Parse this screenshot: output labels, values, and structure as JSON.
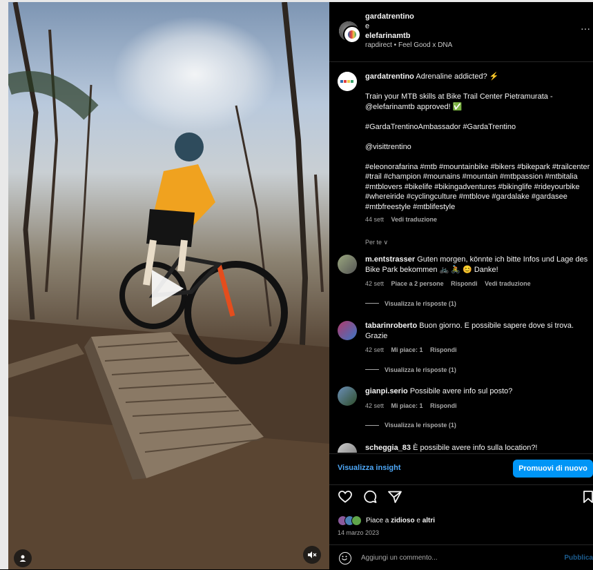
{
  "header": {
    "user1": "gardatrentino",
    "joiner": "e",
    "user2": "elefarinamtb",
    "audio": "rapdirect • Feel Good x DNA",
    "more": "···"
  },
  "caption": {
    "username": "gardatrentino",
    "first_line": "Adrenaline addicted? ⚡",
    "p1": "Train your MTB skills at Bike Trail Center Pietramurata - @elefarinamtb approved! ✅",
    "p2": "#GardaTrentinoAmbassador #GardaTrentino",
    "p3": "@visittrentino",
    "p4": "#eleonorafarina #mtb #mountainbike #bikers #bikepark #trailcenter #trail #champion #mounains #mountain #mtbpassion #mtbitalia #mtblovers #bikelife #bikingadventures #bikinglife #rideyourbike #whereiride #cyclingculture #mtblove #gardalake #gardasee #mtbfreestyle #mtblifestyle",
    "time": "44 sett",
    "translate": "Vedi traduzione",
    "for_you": "Per te ∨"
  },
  "comments": [
    {
      "username": "m.entstrasser",
      "text": "Guten morgen, könnte ich bitte Infos und Lage des Bike Park bekommen 🚲 🚴 😊 Danke!",
      "time": "42 sett",
      "likes": "Piace a 2 persone",
      "reply": "Rispondi",
      "translate": "Vedi traduzione",
      "replies": "Visualizza le risposte (1)"
    },
    {
      "username": "tabarinroberto",
      "text": "Buon giorno. E possibile sapere dove si trova. Grazie",
      "time": "42 sett",
      "likes": "Mi piace: 1",
      "reply": "Rispondi",
      "replies": "Visualizza le risposte (1)"
    },
    {
      "username": "gianpi.serio",
      "text": "Possibile avere info sul posto?",
      "time": "42 sett",
      "likes": "Mi piace: 1",
      "reply": "Rispondi",
      "replies": "Visualizza le risposte (1)"
    },
    {
      "username": "scheggia_83",
      "text": "È possibile avere info sulla location?!"
    }
  ],
  "insights": {
    "link": "Visualizza insight",
    "button": "Promuovi di nuovo"
  },
  "likes": {
    "prefix": "Piace a ",
    "user": "zidioso",
    "middle": " e ",
    "others": "altri"
  },
  "date": "14 marzo 2023",
  "comment_bar": {
    "placeholder": "Aggiungi un commento...",
    "publish": "Pubblica"
  },
  "colors": {
    "accent": "#0095f6",
    "link": "#4ea8f8",
    "background": "#000000"
  }
}
